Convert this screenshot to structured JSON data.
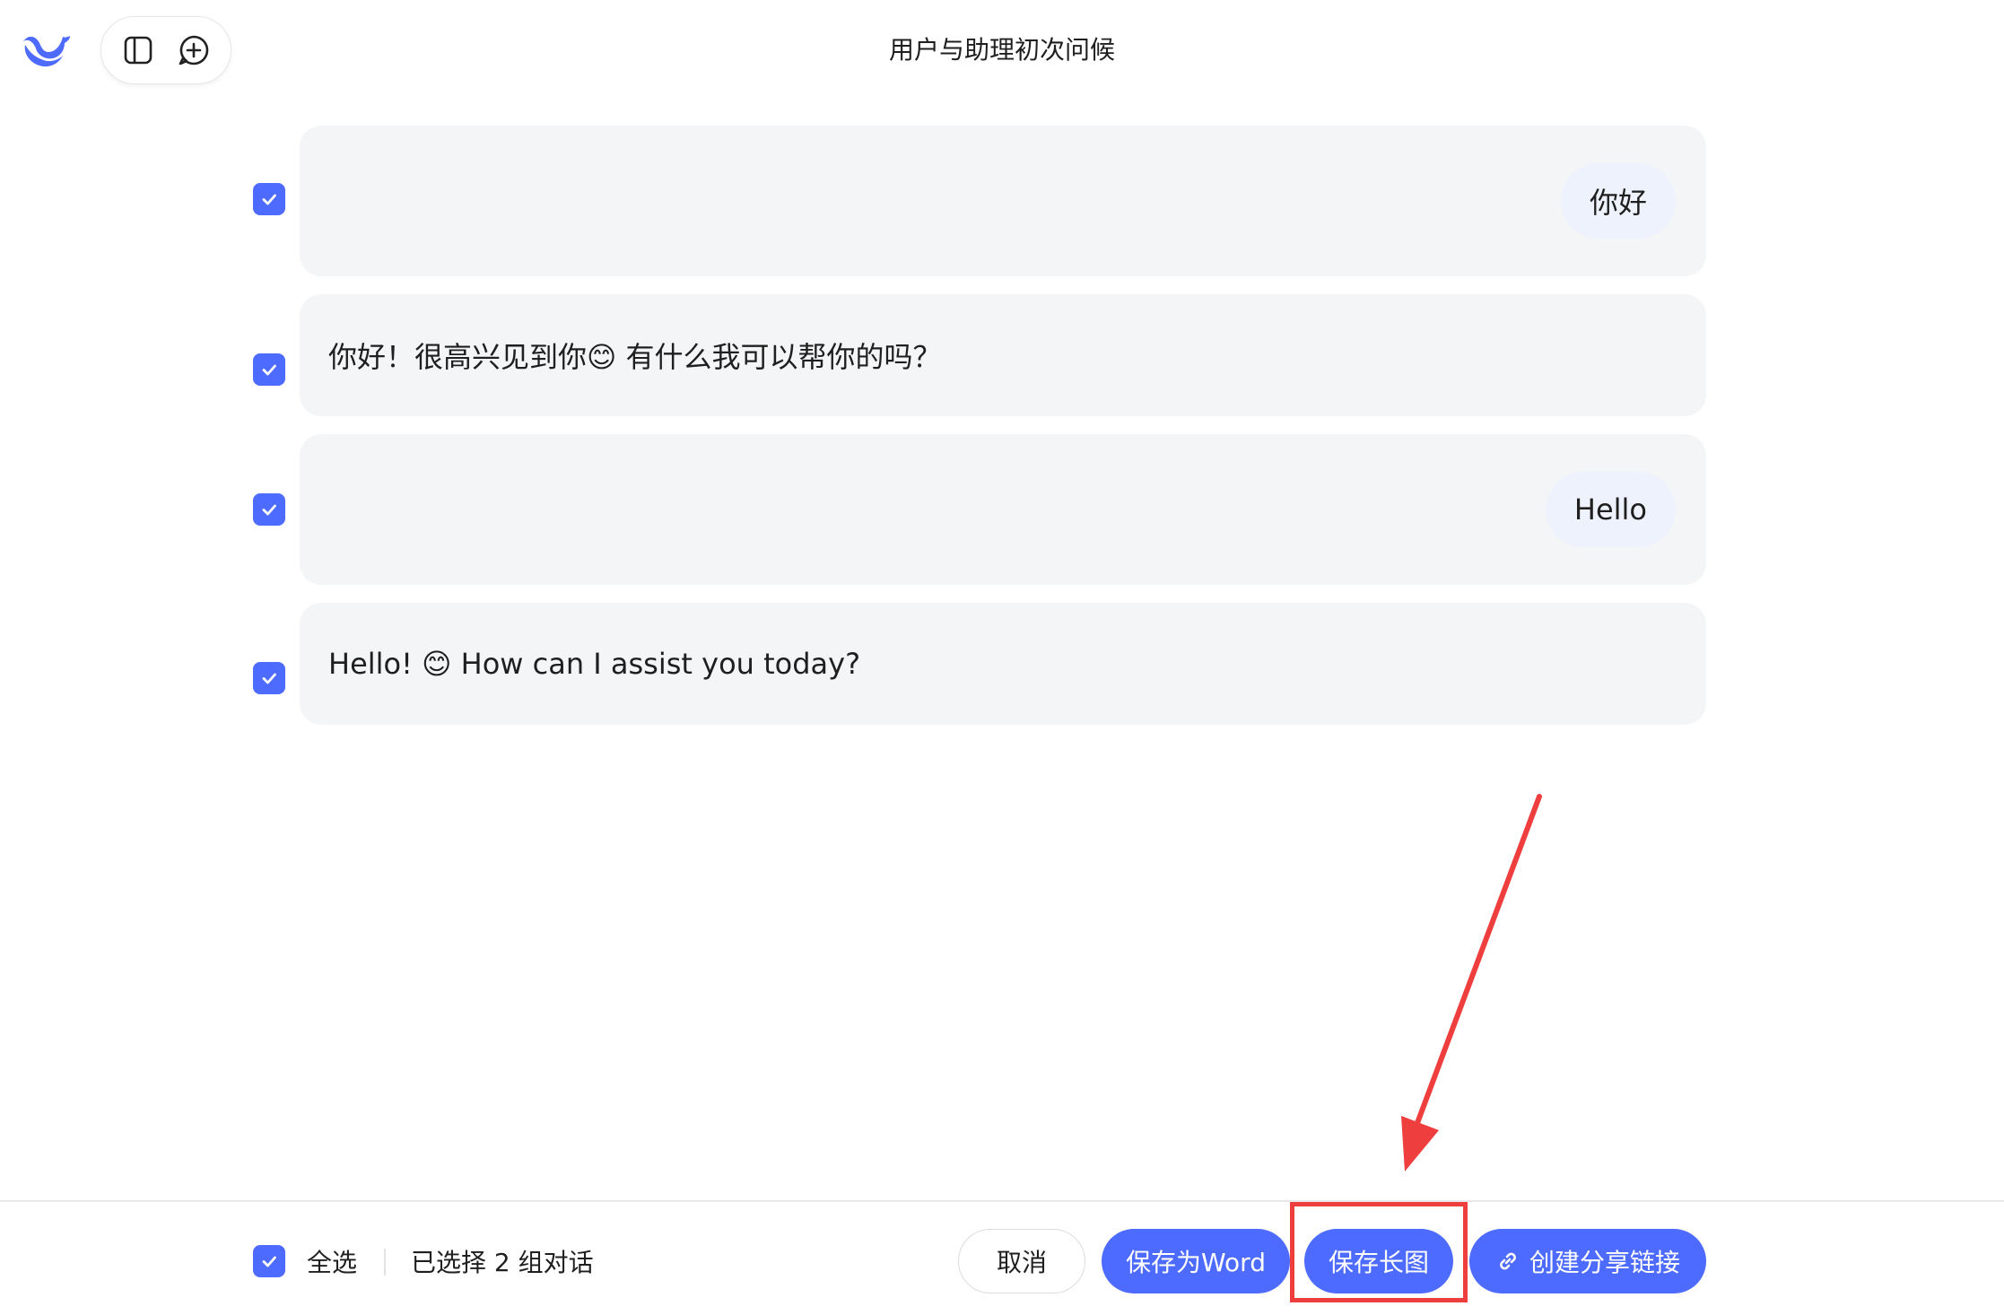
{
  "header": {
    "title": "用户与助理初次问候"
  },
  "toolbar": {
    "sidebar_icon": "sidebar-toggle-icon",
    "new_chat_icon": "new-chat-icon"
  },
  "messages": [
    {
      "role": "user",
      "text": "你好",
      "checked": true
    },
    {
      "role": "assistant",
      "text": "你好！很高兴见到你😊 有什么我可以帮你的吗？",
      "checked": true
    },
    {
      "role": "user",
      "text": "Hello",
      "checked": true
    },
    {
      "role": "assistant",
      "text": "Hello! 😊 How can I assist you today?",
      "checked": true
    }
  ],
  "footer": {
    "select_all_label": "全选",
    "selected_count": "已选择 2 组对话",
    "cancel_label": "取消",
    "save_word_label": "保存为Word",
    "save_image_label": "保存长图",
    "share_link_label": "创建分享链接"
  },
  "colors": {
    "accent": "#4d6bfe",
    "card_bg": "#f4f5f7",
    "user_bubble": "#eef2fc",
    "annotation": "#ef3e3e"
  }
}
